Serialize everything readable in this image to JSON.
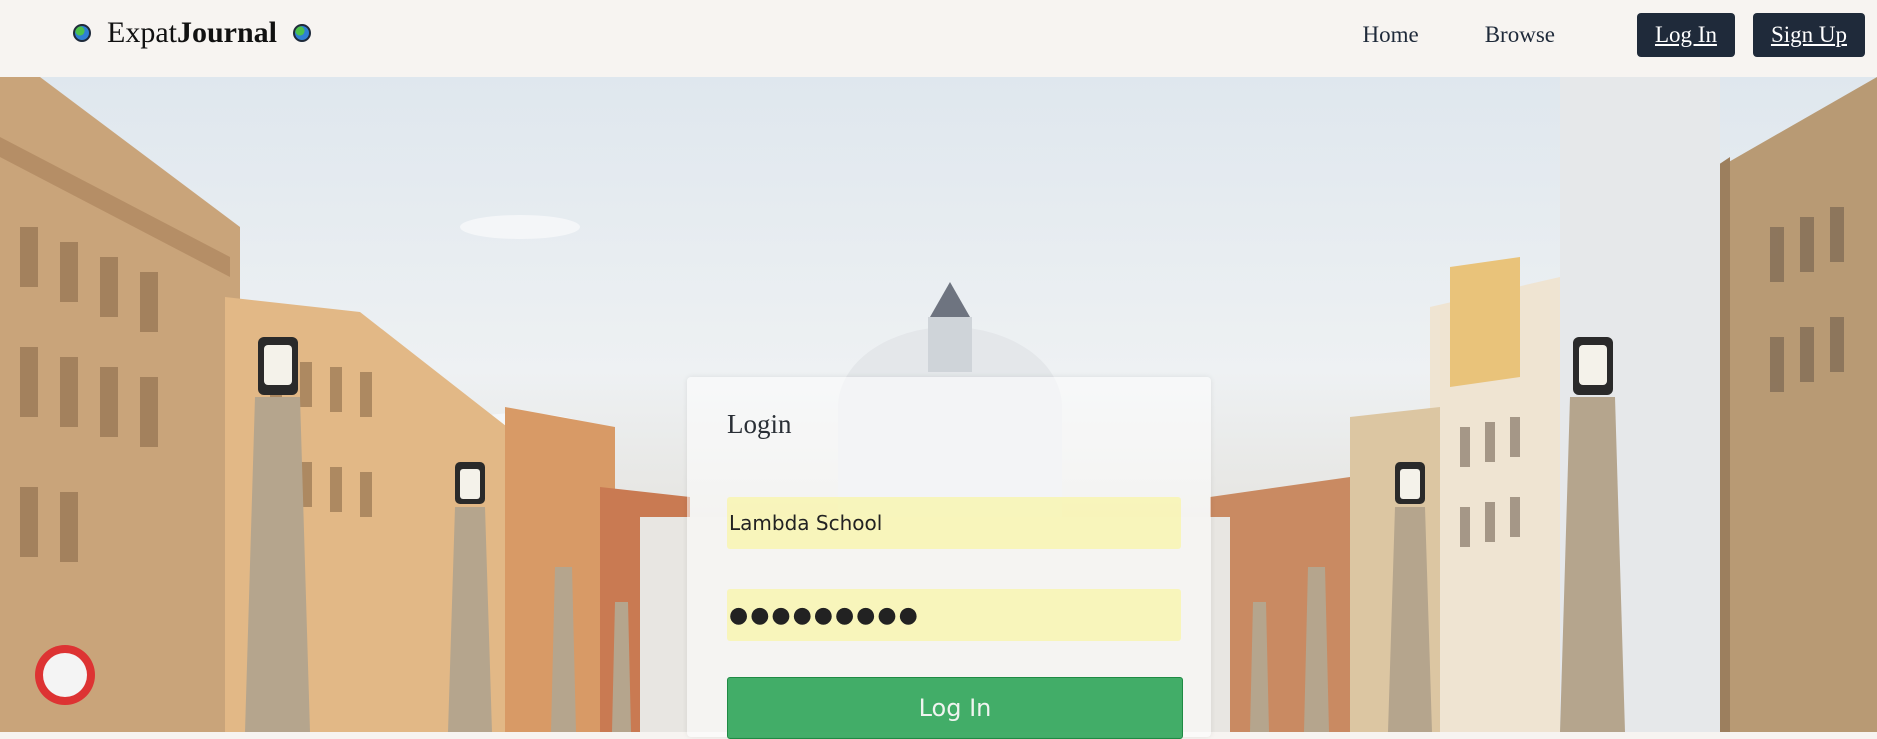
{
  "header": {
    "brand_part1": "Expat",
    "brand_part2": "Journal",
    "icons": [
      "globe-icon",
      "globe-icon"
    ],
    "nav": {
      "home": "Home",
      "browse": "Browse",
      "login": "Log In",
      "signup": "Sign Up"
    }
  },
  "login": {
    "title": "Login",
    "username_value": "Lambda School",
    "password_value": "●●●●●●●●●",
    "submit_label": "Log In"
  },
  "colors": {
    "header_bg": "#f7f4f1",
    "nav_button_bg": "#1f2a3a",
    "field_autofill": "#faf596",
    "submit_green": "#22a050"
  }
}
